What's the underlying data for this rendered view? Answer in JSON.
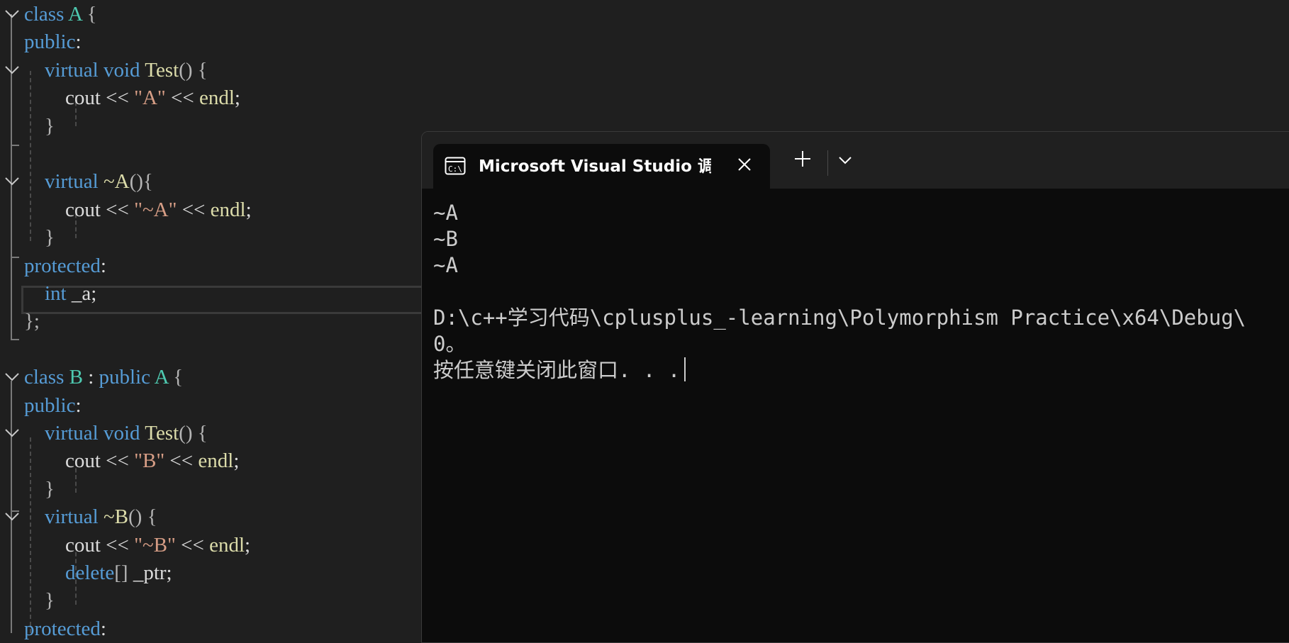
{
  "editor": {
    "lines": [
      [
        [
          "kw",
          "class "
        ],
        [
          "ty",
          "A"
        ],
        [
          "pn",
          " {"
        ]
      ],
      [
        [
          "kw",
          "public"
        ],
        [
          "pl",
          ":"
        ]
      ],
      [
        [
          "pl",
          "    "
        ],
        [
          "kw",
          "virtual "
        ],
        [
          "kw",
          "void "
        ],
        [
          "fn",
          "Test"
        ],
        [
          "pn",
          "() {"
        ]
      ],
      [
        [
          "pl",
          "        cout << "
        ],
        [
          "st",
          "\"A\""
        ],
        [
          "pl",
          " << "
        ],
        [
          "fn",
          "endl"
        ],
        [
          "pl",
          ";"
        ]
      ],
      [
        [
          "pn",
          "    }"
        ]
      ],
      [
        [
          "pl",
          ""
        ]
      ],
      [
        [
          "pl",
          "    "
        ],
        [
          "kw",
          "virtual "
        ],
        [
          "fn",
          "~A"
        ],
        [
          "pn",
          "(){"
        ]
      ],
      [
        [
          "pl",
          "        cout << "
        ],
        [
          "st",
          "\"~A\""
        ],
        [
          "pl",
          " << "
        ],
        [
          "fn",
          "endl"
        ],
        [
          "pl",
          ";"
        ]
      ],
      [
        [
          "pn",
          "    }"
        ]
      ],
      [
        [
          "kw",
          "protected"
        ],
        [
          "pl",
          ":"
        ]
      ],
      [
        [
          "pl",
          "    "
        ],
        [
          "kw",
          "int "
        ],
        [
          "pl",
          "_a;"
        ]
      ],
      [
        [
          "pn",
          "};"
        ]
      ],
      [
        [
          "pl",
          ""
        ]
      ],
      [
        [
          "kw",
          "class "
        ],
        [
          "ty",
          "B"
        ],
        [
          "pl",
          " : "
        ],
        [
          "kw",
          "public "
        ],
        [
          "ty",
          "A"
        ],
        [
          "pn",
          " {"
        ]
      ],
      [
        [
          "kw",
          "public"
        ],
        [
          "pl",
          ":"
        ]
      ],
      [
        [
          "pl",
          "    "
        ],
        [
          "kw",
          "virtual "
        ],
        [
          "kw",
          "void "
        ],
        [
          "fn",
          "Test"
        ],
        [
          "pn",
          "() {"
        ]
      ],
      [
        [
          "pl",
          "        cout << "
        ],
        [
          "st",
          "\"B\""
        ],
        [
          "pl",
          " << "
        ],
        [
          "fn",
          "endl"
        ],
        [
          "pl",
          ";"
        ]
      ],
      [
        [
          "pn",
          "    }"
        ]
      ],
      [
        [
          "pl",
          "    "
        ],
        [
          "kw",
          "virtual "
        ],
        [
          "fn",
          "~B"
        ],
        [
          "pn",
          "() {"
        ]
      ],
      [
        [
          "pl",
          "        cout << "
        ],
        [
          "st",
          "\"~B\""
        ],
        [
          "pl",
          " << "
        ],
        [
          "fn",
          "endl"
        ],
        [
          "pl",
          ";"
        ]
      ],
      [
        [
          "pl",
          "        "
        ],
        [
          "kw",
          "delete"
        ],
        [
          "pn",
          "[] "
        ],
        [
          "pl",
          "_ptr;"
        ]
      ],
      [
        [
          "pn",
          "    }"
        ]
      ],
      [
        [
          "kw",
          "protected"
        ],
        [
          "pl",
          ":"
        ]
      ]
    ]
  },
  "terminal": {
    "tab_title": "Microsoft Visual Studio 调试控制台",
    "output": [
      "~A",
      "~B",
      "~A",
      "",
      "D:\\c++学习代码\\cplusplus_-learning\\Polymorphism Practice\\x64\\Debug\\",
      "0。",
      "按任意键关闭此窗口. . ."
    ]
  },
  "icons": {
    "fold": "chevron-down-icon",
    "terminal": "console-icon",
    "close": "close-icon",
    "new_tab": "plus-icon",
    "dropdown": "chevron-down-icon"
  },
  "colors": {
    "keyword": "#569cd6",
    "type": "#4ec9b0",
    "function": "#dcdcaa",
    "string": "#d69d85",
    "text": "#dcdcdc",
    "terminal_bg": "#0c0c0c",
    "editor_bg": "#1f1f1f"
  }
}
